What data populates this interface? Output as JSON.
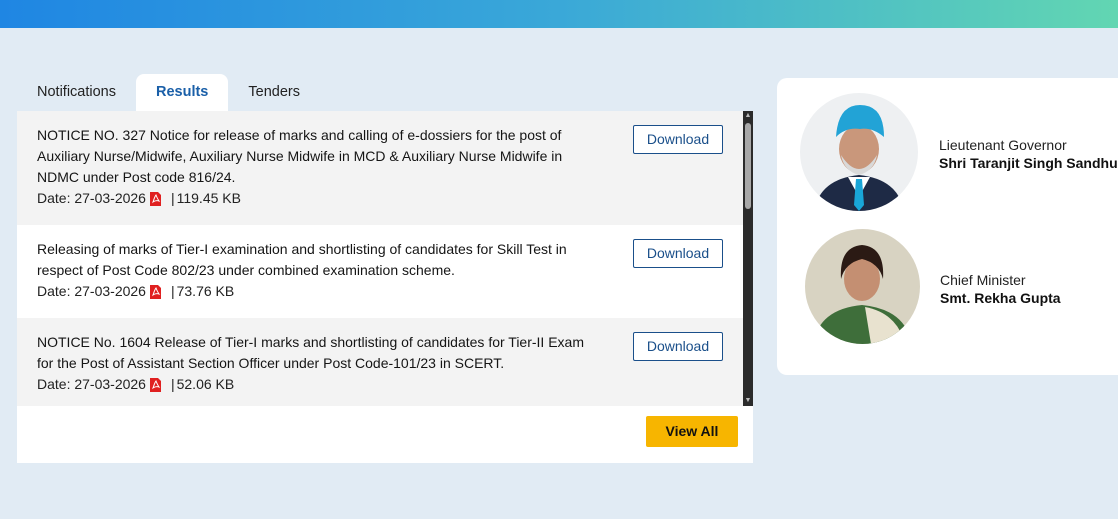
{
  "tabs": [
    {
      "label": "Notifications",
      "active": false
    },
    {
      "label": "Results",
      "active": true
    },
    {
      "label": "Tenders",
      "active": false
    }
  ],
  "results": [
    {
      "title": "NOTICE NO. 327 Notice for release of marks and calling of e-dossiers for the post of Auxiliary Nurse/Midwife, Auxiliary Nurse Midwife in MCD & Auxiliary Nurse Midwife in NDMC under Post code 816/24.",
      "date": "Date: 27-03-2026",
      "size": "119.45 KB",
      "download_label": "Download"
    },
    {
      "title": "Releasing of marks of Tier-I examination and shortlisting of candidates for Skill Test in respect of Post Code 802/23 under combined examination scheme.",
      "date": "Date: 27-03-2026",
      "size": "73.76 KB",
      "download_label": "Download"
    },
    {
      "title": "NOTICE No. 1604 Release of Tier-I marks and shortlisting of candidates for Tier-II Exam for the Post of Assistant Section Officer under Post Code-101/23 in SCERT.",
      "date": "Date: 27-03-2026",
      "size": "52.06 KB",
      "download_label": "Download"
    }
  ],
  "separator": "|",
  "view_all_label": "View All",
  "people": [
    {
      "role": "Lieutenant Governor",
      "name": "Shri Taranjit Singh Sandhu"
    },
    {
      "role": "Chief Minister",
      "name": "Smt. Rekha Gupta"
    }
  ],
  "colors": {
    "accent": "#1a5fa8",
    "button_border": "#1a4f8a",
    "view_all_bg": "#f7b500",
    "page_bg": "#e1ebf4",
    "pdf_icon": "#e02020"
  },
  "icons": {
    "pdf": "pdf-icon",
    "scroll_up": "scroll-up-arrow-icon",
    "scroll_down": "scroll-down-arrow-icon"
  }
}
